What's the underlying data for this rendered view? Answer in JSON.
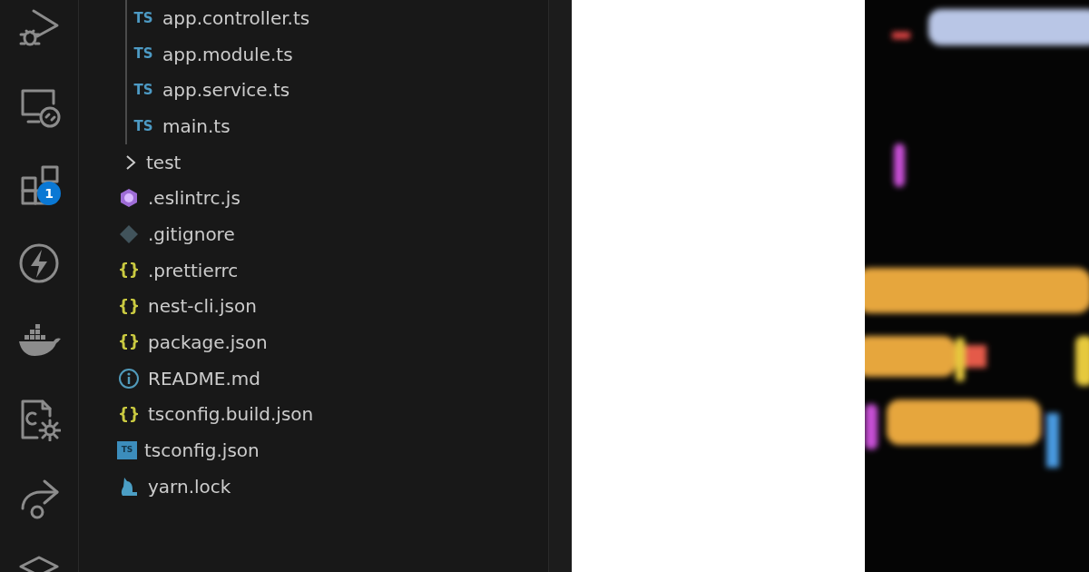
{
  "activity_bar": {
    "items": [
      {
        "kind": "debug"
      },
      {
        "kind": "remote"
      },
      {
        "kind": "extensions",
        "badge": "1"
      },
      {
        "kind": "lightning"
      },
      {
        "kind": "docker"
      },
      {
        "kind": "settings-file"
      },
      {
        "kind": "share"
      },
      {
        "kind": "stack"
      }
    ]
  },
  "explorer": {
    "tree": [
      {
        "children": [
          {
            "kind": "ts",
            "icon_text": "TS",
            "label": "app.controller.ts"
          },
          {
            "kind": "ts",
            "icon_text": "TS",
            "label": "app.module.ts"
          },
          {
            "kind": "ts",
            "icon_text": "TS",
            "label": "app.service.ts"
          },
          {
            "kind": "ts",
            "icon_text": "TS",
            "label": "main.ts"
          }
        ]
      },
      {
        "kind": "folder",
        "label": "test",
        "expanded": false
      },
      {
        "kind": "eslint",
        "label": ".eslintrc.js"
      },
      {
        "kind": "git",
        "label": ".gitignore"
      },
      {
        "kind": "json",
        "icon_text": "{}",
        "label": ".prettierrc"
      },
      {
        "kind": "json",
        "icon_text": "{}",
        "label": "nest-cli.json"
      },
      {
        "kind": "json",
        "icon_text": "{}",
        "label": "package.json"
      },
      {
        "kind": "info",
        "label": "README.md"
      },
      {
        "kind": "json",
        "icon_text": "{}",
        "label": "tsconfig.build.json"
      },
      {
        "kind": "tsconfig",
        "icon_text": "TS",
        "label": "tsconfig.json"
      },
      {
        "kind": "yarn",
        "label": "yarn.lock"
      }
    ]
  }
}
